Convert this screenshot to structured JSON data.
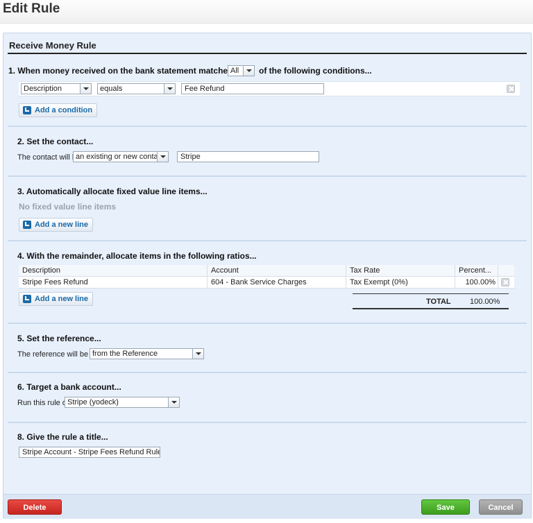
{
  "page": {
    "title": "Edit Rule"
  },
  "panel": {
    "title": "Receive Money Rule"
  },
  "section1": {
    "heading_prefix": "1. When money received on the bank statement matches",
    "match_value": "All",
    "heading_suffix": "of the following conditions...",
    "condition": {
      "field": "Description",
      "operator": "equals",
      "value": "Fee Refund"
    },
    "add_condition_label": "Add a condition"
  },
  "section2": {
    "heading": "2. Set the contact...",
    "label": "The contact will be",
    "contact_mode": "an existing or new contact",
    "contact_value": "Stripe"
  },
  "section3": {
    "heading": "3. Automatically allocate fixed value line items...",
    "empty_text": "No fixed value line items",
    "add_line_label": "Add a new line"
  },
  "section4": {
    "heading": "4. With the remainder, allocate items in the following ratios...",
    "columns": {
      "description": "Description",
      "account": "Account",
      "tax_rate": "Tax Rate",
      "percent": "Percent..."
    },
    "rows": [
      {
        "description": "Stripe Fees Refund",
        "account": "604 - Bank Service Charges",
        "tax_rate": "Tax Exempt (0%)",
        "percent": "100.00%"
      }
    ],
    "add_line_label": "Add a new line",
    "total_label": "TOTAL",
    "total_value": "100.00%"
  },
  "section5": {
    "heading": "5. Set the reference...",
    "label": "The reference will be set",
    "reference_mode": "from the Reference"
  },
  "section6": {
    "heading": "6. Target a bank account...",
    "label": "Run this rule on",
    "account": "Stripe (yodeck)"
  },
  "section8": {
    "heading": "8. Give the rule a title...",
    "title_value": "Stripe Account - Stripe Fees Refund Rule"
  },
  "footer": {
    "delete_label": "Delete",
    "save_label": "Save",
    "cancel_label": "Cancel"
  },
  "colors": {
    "delete": "#d32f2f",
    "save": "#4caf2c",
    "cancel": "#9e9e9e",
    "accent": "#1a6aa8"
  }
}
